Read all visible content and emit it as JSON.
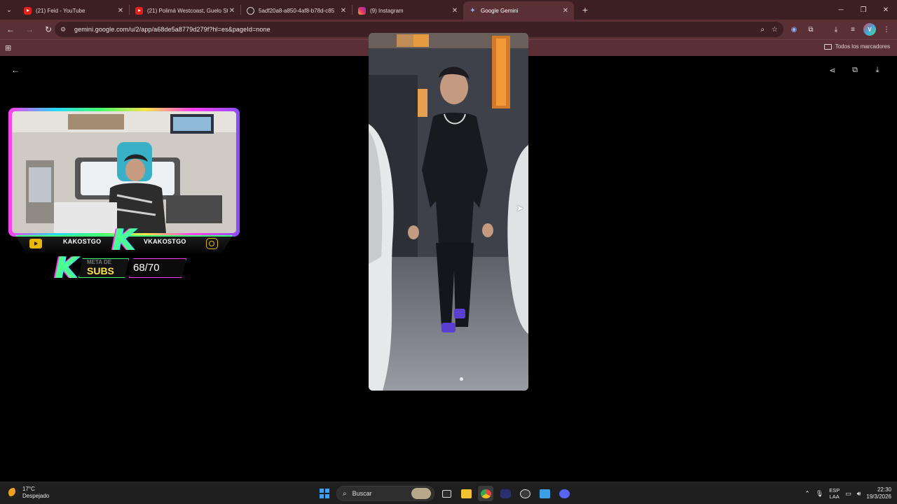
{
  "browser": {
    "tabs": [
      {
        "label": "(21) Feid - YouTube",
        "favicon": "youtube-icon",
        "active": false
      },
      {
        "label": "(21) Polimá Westcoast, Guelo Star",
        "favicon": "youtube-icon",
        "active": false
      },
      {
        "label": "5adf20a8-a850-4af8-b78d-c85",
        "favicon": "globe-icon",
        "active": false
      },
      {
        "label": "(9) Instagram",
        "favicon": "instagram-icon",
        "active": false
      },
      {
        "label": "Google Gemini",
        "favicon": "gemini-icon",
        "active": true
      }
    ],
    "url": "gemini.google.com/u/2/app/a68de5a8779d279f?hl=es&pageId=none",
    "bookmarks_all_label": "Todos los marcadores",
    "accent_color": "#5a3034"
  },
  "overlay": {
    "youtube_handle": "KAKOSTGO",
    "instagram_handle": "VKAKOSTGO",
    "subs_meta_label": "META DE",
    "subs_label": "SUBS",
    "subs_count": "68/70"
  },
  "taskbar": {
    "weather_temp": "17°C",
    "weather_desc": "Despejado",
    "search_placeholder": "Buscar",
    "lang_top": "ESP",
    "lang_bottom": "LAA",
    "time": "22:30",
    "date": "19/3/2026"
  }
}
